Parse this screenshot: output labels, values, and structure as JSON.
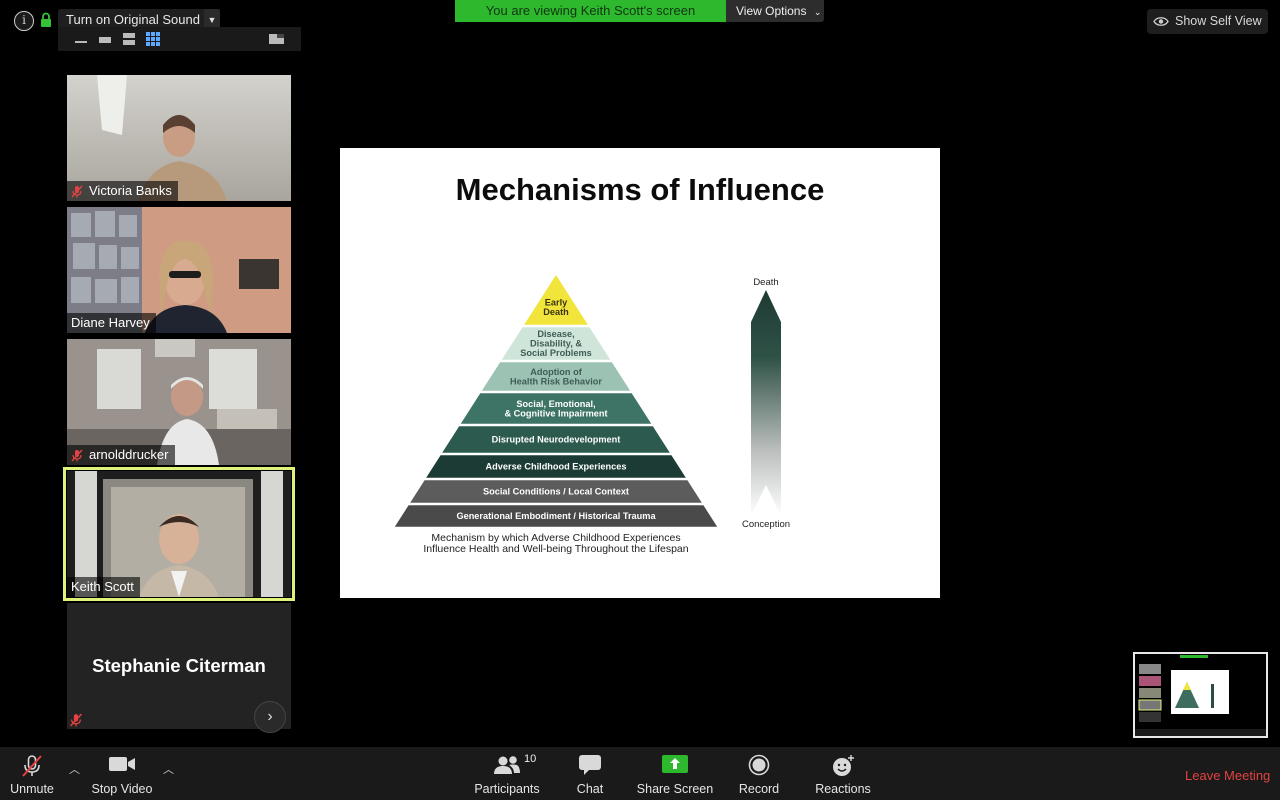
{
  "top_left": {
    "original_sound_label": "Turn on Original Sound"
  },
  "banner": {
    "viewing_text": "You are viewing Keith Scott's screen",
    "view_options_label": "View Options"
  },
  "self_view": {
    "label": "Show Self View"
  },
  "participants": [
    {
      "name": "Victoria Banks",
      "muted": true
    },
    {
      "name": "Diane Harvey",
      "muted": false
    },
    {
      "name": "arnolddrucker",
      "muted": true
    },
    {
      "name": "Keith Scott",
      "muted": false,
      "active_speaker": true
    },
    {
      "name": "Stephanie Citerman",
      "muted": true
    }
  ],
  "slide": {
    "title": "Mechanisms of Influence",
    "pyramid_levels": [
      {
        "text": [
          "Early",
          "Death"
        ],
        "color": "#f1e43a"
      },
      {
        "text": [
          "Disease,",
          "Disability, &",
          "Social Problems"
        ],
        "color": "#cfe5da"
      },
      {
        "text": [
          "Adoption of",
          "Health Risk Behavior"
        ],
        "color": "#9cc2b3"
      },
      {
        "text": [
          "Social, Emotional,",
          "& Cognitive Impairment"
        ],
        "color": "#3e7466"
      },
      {
        "text": [
          "Disrupted Neurodevelopment"
        ],
        "color": "#2c5a4e"
      },
      {
        "text": [
          "Adverse Childhood Experiences"
        ],
        "color": "#1c3b35"
      },
      {
        "text": [
          "Social Conditions / Local Context"
        ],
        "color": "#5c5c5c"
      },
      {
        "text": [
          "Generational Embodiment / Historical Trauma"
        ],
        "color": "#4a4a4a"
      }
    ],
    "caption_line1": "Mechanism by which Adverse Childhood Experiences",
    "caption_line2": "Influence Health and Well-being Throughout the Lifespan",
    "arrow_top_label": "Death",
    "arrow_bottom_label": "Conception"
  },
  "toolbar": {
    "unmute": "Unmute",
    "stop_video": "Stop Video",
    "participants": "Participants",
    "participants_count": "10",
    "chat": "Chat",
    "share_screen": "Share Screen",
    "record": "Record",
    "reactions": "Reactions",
    "leave": "Leave Meeting"
  },
  "colors": {
    "banner_green": "#2eb82e",
    "active_speaker_border": "#dff27a",
    "share_green": "#2eb82e",
    "leave_red": "#e34242"
  }
}
